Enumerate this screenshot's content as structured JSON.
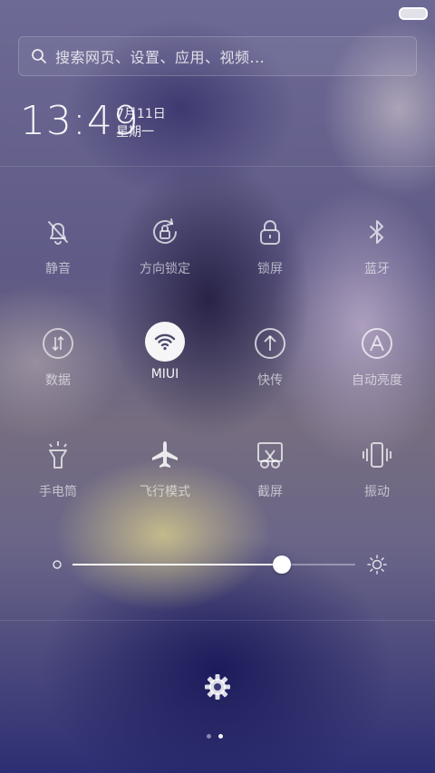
{
  "search": {
    "placeholder": "搜索网页、设置、应用、视频..."
  },
  "clock": {
    "time": "13:49",
    "date": "7月11日",
    "weekday": "星期一"
  },
  "toggles": [
    {
      "label": "静音",
      "icon": "mute-bell-icon",
      "active": false
    },
    {
      "label": "方向锁定",
      "icon": "rotation-lock-icon",
      "active": false
    },
    {
      "label": "锁屏",
      "icon": "lock-icon",
      "active": false
    },
    {
      "label": "蓝牙",
      "icon": "bluetooth-icon",
      "active": false
    },
    {
      "label": "数据",
      "icon": "mobile-data-icon",
      "active": false
    },
    {
      "label": "MIUI",
      "icon": "wifi-icon",
      "active": true
    },
    {
      "label": "快传",
      "icon": "quick-transfer-icon",
      "active": false
    },
    {
      "label": "自动亮度",
      "icon": "auto-brightness-icon",
      "active": false
    },
    {
      "label": "手电筒",
      "icon": "flashlight-icon",
      "active": false
    },
    {
      "label": "飞行模式",
      "icon": "airplane-icon",
      "active": false
    },
    {
      "label": "截屏",
      "icon": "screenshot-icon",
      "active": false
    },
    {
      "label": "振动",
      "icon": "vibrate-icon",
      "active": false
    }
  ],
  "brightness": {
    "level": 0.74
  },
  "pager": {
    "pages": 2,
    "current": 2
  },
  "colors": {
    "accent": "#ffffff",
    "active_icon": "#4a4a6a"
  }
}
